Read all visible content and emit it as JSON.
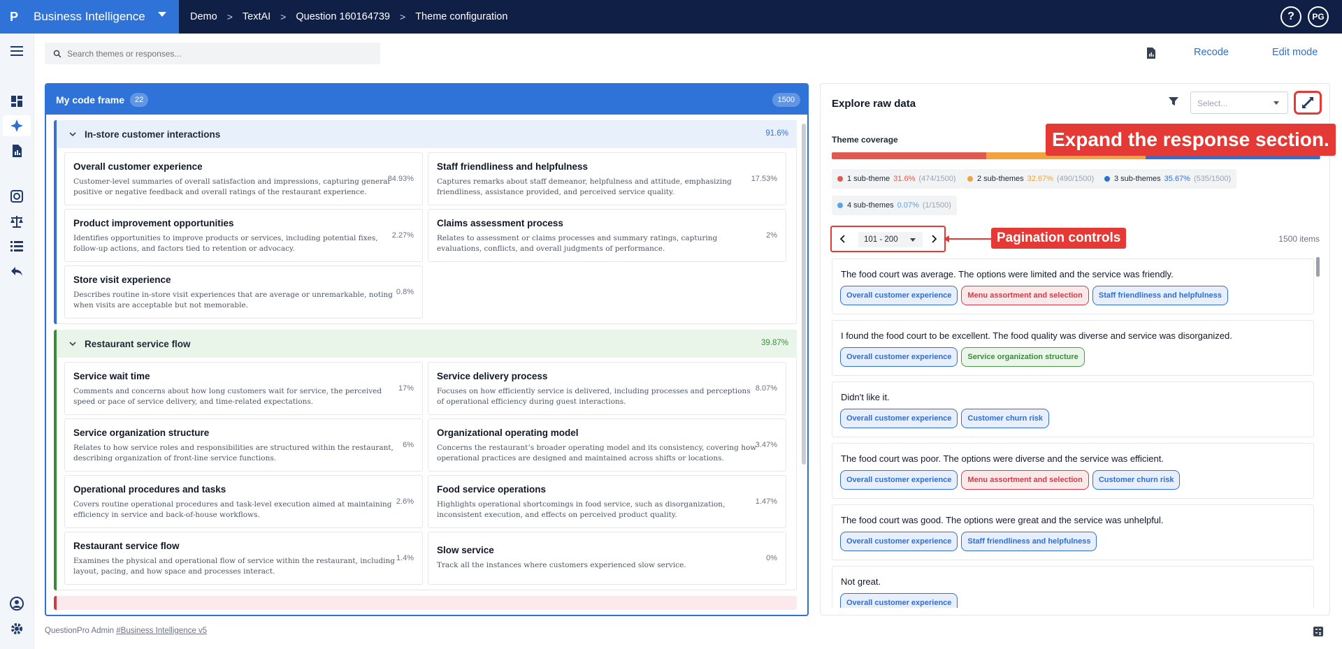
{
  "app": {
    "logo": "P",
    "title": "Business Intelligence",
    "user_initials": "PG",
    "help": "?"
  },
  "breadcrumb": [
    "Demo",
    "TextAI",
    "Question 160164739",
    "Theme configuration"
  ],
  "search": {
    "placeholder": "Search themes or responses..."
  },
  "toolbar": {
    "recode": "Recode",
    "edit_mode": "Edit mode"
  },
  "code_frame": {
    "title": "My code frame",
    "count": "22",
    "total": "1500",
    "groups": [
      {
        "title": "In-store customer interactions",
        "pct": "91.6%",
        "color": "#3b6fd1",
        "header_bg": "#e8f0fb",
        "items": [
          {
            "title": "Overall customer experience",
            "desc": "Customer-level summaries of overall satisfaction and impressions, capturing general positive or negative feedback and overall ratings of the restaurant experience.",
            "pct": "84.93%"
          },
          {
            "title": "Staff friendliness and helpfulness",
            "desc": "Captures remarks about staff demeanor, helpfulness and attitude, emphasizing friendliness, assistance provided, and perceived service quality.",
            "pct": "17.53%"
          },
          {
            "title": "Product improvement opportunities",
            "desc": "Identifies opportunities to improve products or services, including potential fixes, follow-up actions, and factors tied to retention or advocacy.",
            "pct": "2.27%"
          },
          {
            "title": "Claims assessment process",
            "desc": "Relates to assessment or claims processes and summary ratings, capturing evaluations, conflicts, and overall judgments of performance.",
            "pct": "2%"
          },
          {
            "title": "Store visit experience",
            "desc": "Describes routine in-store visit experiences that are average or unremarkable, noting when visits are acceptable but not memorable.",
            "pct": "0.8%"
          }
        ]
      },
      {
        "title": "Restaurant service flow",
        "pct": "39.87%",
        "color": "#3d8a3d",
        "header_bg": "#e9f5e8",
        "items": [
          {
            "title": "Service wait time",
            "desc": "Comments and concerns about how long customers wait for service, the perceived speed or pace of service delivery, and time-related expectations.",
            "pct": "17%"
          },
          {
            "title": "Service delivery process",
            "desc": "Focuses on how efficiently service is delivered, including processes and perceptions of operational efficiency during guest interactions.",
            "pct": "8.07%"
          },
          {
            "title": "Service organization structure",
            "desc": "Relates to how service roles and responsibilities are structured within the restaurant, describing organization of front-line service functions.",
            "pct": "6%"
          },
          {
            "title": "Organizational operating model",
            "desc": "Concerns the restaurant’s broader operating model and its consistency, covering how operational practices are designed and maintained across shifts or locations.",
            "pct": "3.47%"
          },
          {
            "title": "Operational procedures and tasks",
            "desc": "Covers routine operational procedures and task-level execution aimed at maintaining efficiency in service and back-of-house workflows.",
            "pct": "2.6%"
          },
          {
            "title": "Food service operations",
            "desc": "Highlights operational shortcomings in food service, such as disorganization, inconsistent execution, and effects on perceived product quality.",
            "pct": "1.47%"
          },
          {
            "title": "Restaurant service flow",
            "desc": "Examines the physical and operational flow of service within the restaurant, including layout, pacing, and how space and processes interact.",
            "pct": "1.4%"
          },
          {
            "title": "Slow service",
            "desc": "Track all the instances where customers experienced slow service.",
            "pct": "0%"
          }
        ]
      }
    ]
  },
  "panel": {
    "title": "Explore raw data",
    "select_placeholder": "Select...",
    "coverage_label": "Theme coverage",
    "coverage": [
      {
        "name": "1 sub-theme",
        "pct": "31.6%",
        "frac": "(474/1500)",
        "value": 31.6,
        "color": "#e05a4f"
      },
      {
        "name": "2 sub-themes",
        "pct": "32.67%",
        "frac": "(490/1500)",
        "value": 32.67,
        "color": "#f0a340"
      },
      {
        "name": "3 sub-themes",
        "pct": "35.67%",
        "frac": "(535/1500)",
        "value": 35.67,
        "color": "#2f6fd1"
      },
      {
        "name": "4 sub-themes",
        "pct": "0.07%",
        "frac": "(1/1500)",
        "value": 0.07,
        "color": "#5ba3e8"
      }
    ],
    "pager": {
      "range": "101 - 200"
    },
    "items_count": "1500 items",
    "responses": [
      {
        "text": "The food court was average. The options were limited and the service was friendly.",
        "tags": [
          {
            "label": "Overall customer experience",
            "tone": "blue"
          },
          {
            "label": "Menu assortment and selection",
            "tone": "red"
          },
          {
            "label": "Staff friendliness and helpfulness",
            "tone": "blue"
          }
        ]
      },
      {
        "text": "I found the food court to be excellent. The food quality was diverse and service was disorganized.",
        "tags": [
          {
            "label": "Overall customer experience",
            "tone": "blue"
          },
          {
            "label": "Service organization structure",
            "tone": "green"
          }
        ]
      },
      {
        "text": "Didn't like it.",
        "tags": [
          {
            "label": "Overall customer experience",
            "tone": "blue"
          },
          {
            "label": "Customer churn risk",
            "tone": "blue"
          }
        ]
      },
      {
        "text": "The food court was poor. The options were diverse and the service was efficient.",
        "tags": [
          {
            "label": "Overall customer experience",
            "tone": "blue"
          },
          {
            "label": "Menu assortment and selection",
            "tone": "red"
          },
          {
            "label": "Customer churn risk",
            "tone": "blue"
          }
        ]
      },
      {
        "text": "The food court was good. The options were great and the service was unhelpful.",
        "tags": [
          {
            "label": "Overall customer experience",
            "tone": "blue"
          },
          {
            "label": "Staff friendliness and helpfulness",
            "tone": "blue"
          }
        ]
      },
      {
        "text": "Not great.",
        "tags": [
          {
            "label": "Overall customer experience",
            "tone": "blue"
          }
        ]
      }
    ]
  },
  "annotations": {
    "expand": "Expand the response section.",
    "pager": "Pagination controls"
  },
  "footer": {
    "text": "QuestionPro Admin ",
    "link": "#Business Intelligence v5"
  }
}
